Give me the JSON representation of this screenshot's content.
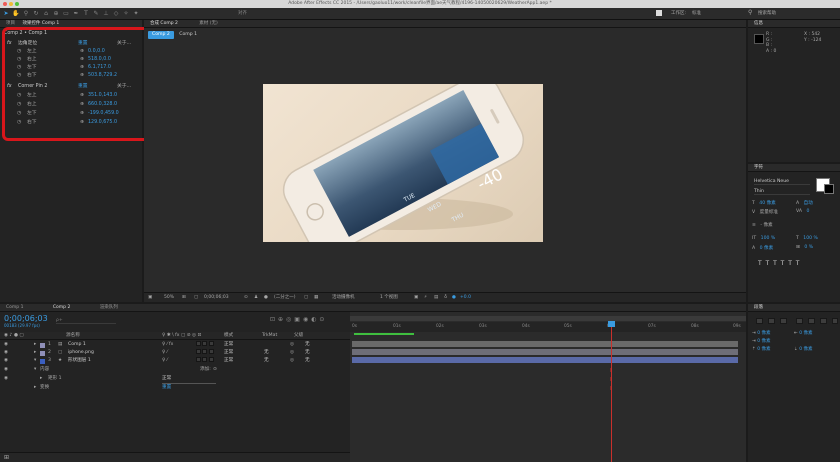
{
  "window": {
    "title": "Adobe After Effects CC 2015 - /Users/gaoluo11/work/cleanfile界面/ae天气教程/4196-14050020629/WeatherApp1.aep *"
  },
  "toolbar": {
    "snap_label": "对齐",
    "workspace_label": "工作区:",
    "workspace_value": "标准",
    "search_help": "搜索帮助"
  },
  "left_panel": {
    "tabs": [
      "项目",
      "效果控件 Comp 1"
    ],
    "layer_path": "Comp 2 • Comp 1",
    "effects": [
      {
        "name": "边角定位",
        "reset": "重置",
        "about": "关于...",
        "params": [
          {
            "label": "左上",
            "value": "0.0,0.0"
          },
          {
            "label": "右上",
            "value": "518.0,0.0"
          },
          {
            "label": "左下",
            "value": "6.1,717.0"
          },
          {
            "label": "右下",
            "value": "503.8,729.2"
          }
        ]
      },
      {
        "name": "Corner Pin 2",
        "reset": "重置",
        "about": "关于...",
        "params": [
          {
            "label": "左上",
            "value": "351.0,143.0"
          },
          {
            "label": "右上",
            "value": "660.0,328.0"
          },
          {
            "label": "左下",
            "value": "-199.0,459.0"
          },
          {
            "label": "右下",
            "value": "129.0,675.0"
          }
        ]
      }
    ]
  },
  "composition": {
    "panel_tabs": [
      "合成 Comp 2",
      "素材 (无)"
    ],
    "view_tabs": [
      "Comp 2",
      "Comp 1"
    ],
    "zoom": "50%",
    "timecode": "0;00;06;03",
    "resolution": "(二分之一)",
    "camera": "活动摄像机",
    "views": "1 个视图",
    "exposure": "+0.0",
    "phone_temp": "-40",
    "phone_texts": [
      "TUE",
      "WED",
      "THU"
    ]
  },
  "info_panel": {
    "title": "信息",
    "r": "R :",
    "g": "G :",
    "b": "B :",
    "a": "A : 0",
    "x": "X : 542",
    "y": "Y : -124"
  },
  "char_panel": {
    "title": "字符",
    "font": "Helvetica Neue",
    "style": "Thin",
    "size": "40 像素",
    "leading": "自动",
    "tracking_label": "度量标准",
    "tracking": "0",
    "stroke": "- 像素",
    "v_scale": "100 %",
    "h_scale": "100 %",
    "baseline": "0 像素",
    "tsume": "0 %"
  },
  "para_panel": {
    "title": "段落",
    "indent1": "0 像素",
    "indent2": "0 像素",
    "indent3": "0 像素",
    "space1": "0 像素",
    "space2": "0 像素"
  },
  "timeline": {
    "tabs": [
      "Comp 1",
      "Comp 2",
      "渲染队列"
    ],
    "timecode": "0;00;06;03",
    "frames": "00183 (29.97 fps)",
    "search_placeholder": "ρ+",
    "headers": {
      "name": "源名称",
      "mode": "模式",
      "trkmat": "TrkMat",
      "parent": "父级"
    },
    "layers": [
      {
        "num": "1",
        "name": "Comp 1",
        "mode": "正常",
        "trk": "",
        "parent": "无"
      },
      {
        "num": "2",
        "name": "iphone.png",
        "mode": "正常",
        "trk": "无",
        "parent": "无"
      },
      {
        "num": "3",
        "name": "形状图层 1",
        "mode": "正常",
        "trk": "无",
        "parent": "无"
      }
    ],
    "sub_rows": [
      {
        "label": "内容",
        "extra": "添加:"
      },
      {
        "label": "矩形 1",
        "extra": "正常"
      },
      {
        "label": "变换",
        "extra": "重置"
      }
    ],
    "ruler": [
      "0s",
      "01s",
      "02s",
      "03s",
      "04s",
      "05s",
      "06s",
      "07s",
      "08s",
      "09s"
    ]
  },
  "colors": {
    "accent": "#3a9be0",
    "annotation": "#d8161b",
    "playhead": "#c9302c"
  }
}
